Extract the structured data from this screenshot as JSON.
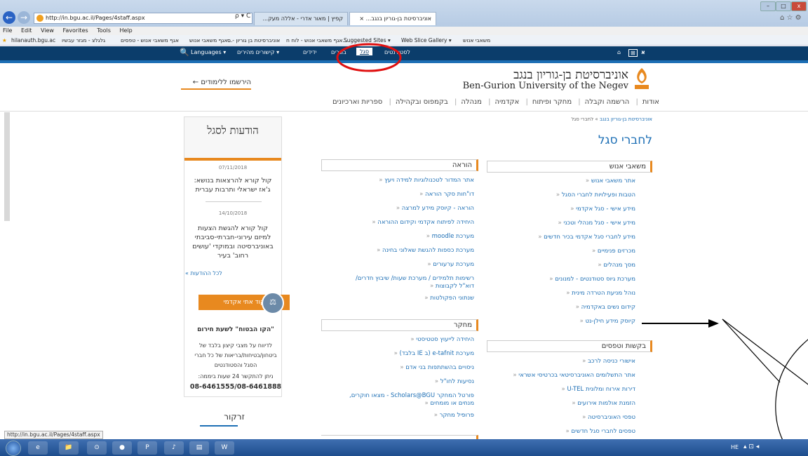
{
  "browser": {
    "address": "http://in.bgu.ac.il/Pages/4staff.aspx",
    "address_controls": "ρ ▾ C",
    "tabs": [
      {
        "label": "קפיץ | מאור אדרי - אללה מעק..."
      },
      {
        "label": "אוניברסיטת בן-גוריון בנגב..."
      }
    ],
    "tab_close": "×",
    "menu": [
      "File",
      "Edit",
      "View",
      "Favorites",
      "Tools",
      "Help"
    ],
    "favorites": [
      "hilanauth.bgu.ac",
      "גלגלצ - מגזר עבשיו",
      "אגף משאבי אנוש - טפסים",
      "אגף משאבי אנוש...",
      "אוניברסיטת בן גוריון - ס",
      "אגף משאבי אנוש - לוח ח...",
      "Suggested Sites ▾",
      "Web Slice Gallery ▾",
      "משאבי אנוש"
    ],
    "status_url": "http://in.bgu.ac.il/Pages/4staff.aspx"
  },
  "topbar": {
    "languages": "Languages ▾",
    "quick_links": "קישורים מהירים ▾",
    "items": [
      "ידידים",
      "בוגרים",
      "סגל",
      "לסטודנטים"
    ],
    "active": "סגל",
    "right_logo": "א"
  },
  "header": {
    "logo_he": "אוניברסיטת בן-גוריון בנגב",
    "logo_en": "Ben-Gurion University of the Negev",
    "register": "הירשמו ללימודים ←"
  },
  "nav": [
    "אודות",
    "הרשמה וקבלה",
    "מחקר ופיתוח",
    "אקדמיה",
    "מנהלה",
    "בקמפוס ובקהילה",
    "ספריות וארכיונים"
  ],
  "breadcrumb": {
    "home": "אוניברסיטת בן-גוריון בנגב",
    "sep": "»",
    "current": "לחברי סגל"
  },
  "page_title": "לחברי סגל",
  "columns": {
    "hr": {
      "title": "משאבי אנוש",
      "links": [
        "אתר משאבי אנוש",
        "הטבות ופעילויות לחברי הסגל",
        "מידע אישי - סגל אקדמי",
        "מידע אישי - סגל מנהלי וטכני",
        "מידע לחברי סגל אקדמי בכיר חדשים",
        "מכרזים פנימיים",
        "מסך מנהלים",
        "מערכת גיוס סטודנטים - למנונים",
        "נוהל מניעת הטרדה מינית",
        "קידום נשים באקדמיה",
        "קיוסק מידע חילן-נט"
      ]
    },
    "requests": {
      "title": "בקשות וטפסים",
      "links": [
        "אישורי כניסה לרכב",
        "אתר התשלומים האוניברסיטאי בכרטיסי אשראי",
        "דירות אירוח ומלונית U-TEL",
        "הזמנת אולמות אירועים",
        "טפסי האוניברסיטה",
        "טפסים לחברי סגל חדשים"
      ]
    },
    "teaching": {
      "title": "הוראה",
      "links": [
        "אתר המדור לטכנולוגיות למידה ויעץ",
        "דו\"חות סקר הוראה",
        "הוראה - קיוסק מידע למרצה",
        "היחידה לפיתוח אקדמי וקידום ההוראה",
        "מערכת moodle",
        "מערכת כספות להגשת שאלוני בחינה",
        "מערכת ערעורים",
        "רשימות תלמידים / מערכת שעות/ שיבוץ חדרים/ דוא\"ל לקבוצות",
        "שנתוני הפקולטות"
      ]
    },
    "research": {
      "title": "מחקר",
      "links": [
        "היחידה לייעוץ סטטיסטי",
        "מערכת e-tafnit (ב IE בלבד)",
        "ניסויים בהשתתפות בני אדם",
        "נסיעות לחו\"ל",
        "פורטל המחקר Scholars@BGU - מצאו חוקרים, מנחים או מומחים",
        "פרופיל מחקר"
      ]
    }
  },
  "news": {
    "title": "הודעות לסגל",
    "items": [
      {
        "date": "07/11/2018",
        "text": "קול קורא להרצאות בנושא: ג'אז ישראלי ותרבות עברית"
      },
      {
        "date": "14/10/2018",
        "text": "קול קורא להגשת הצעות למיזם עירוני-חברתי-סביבתי באוניברסיטה ובמוקדי 'עושים רחוב' בעיר"
      }
    ],
    "all_link": "לכל ההודעות »"
  },
  "ethics": {
    "label": "קוד אתי אקדמי",
    "hotline_title": "\"הקו הבטוח\" לשעת חירום",
    "hotline_text": "לדיווח על מצבי קיצון בלבד של ביטחון/בטיחות/בריאות של כל חברי הסגל והסטודנטים",
    "hours": "ניתן להתקשר 24 שעות ביממה:",
    "phone": "08-6461555/08-6461888"
  },
  "spotlight": "זרקור",
  "taskbar": {
    "lang": "HE",
    "apps": [
      "e",
      "📁",
      "⊙",
      "●",
      "P",
      "♪",
      "▤",
      "W"
    ]
  }
}
